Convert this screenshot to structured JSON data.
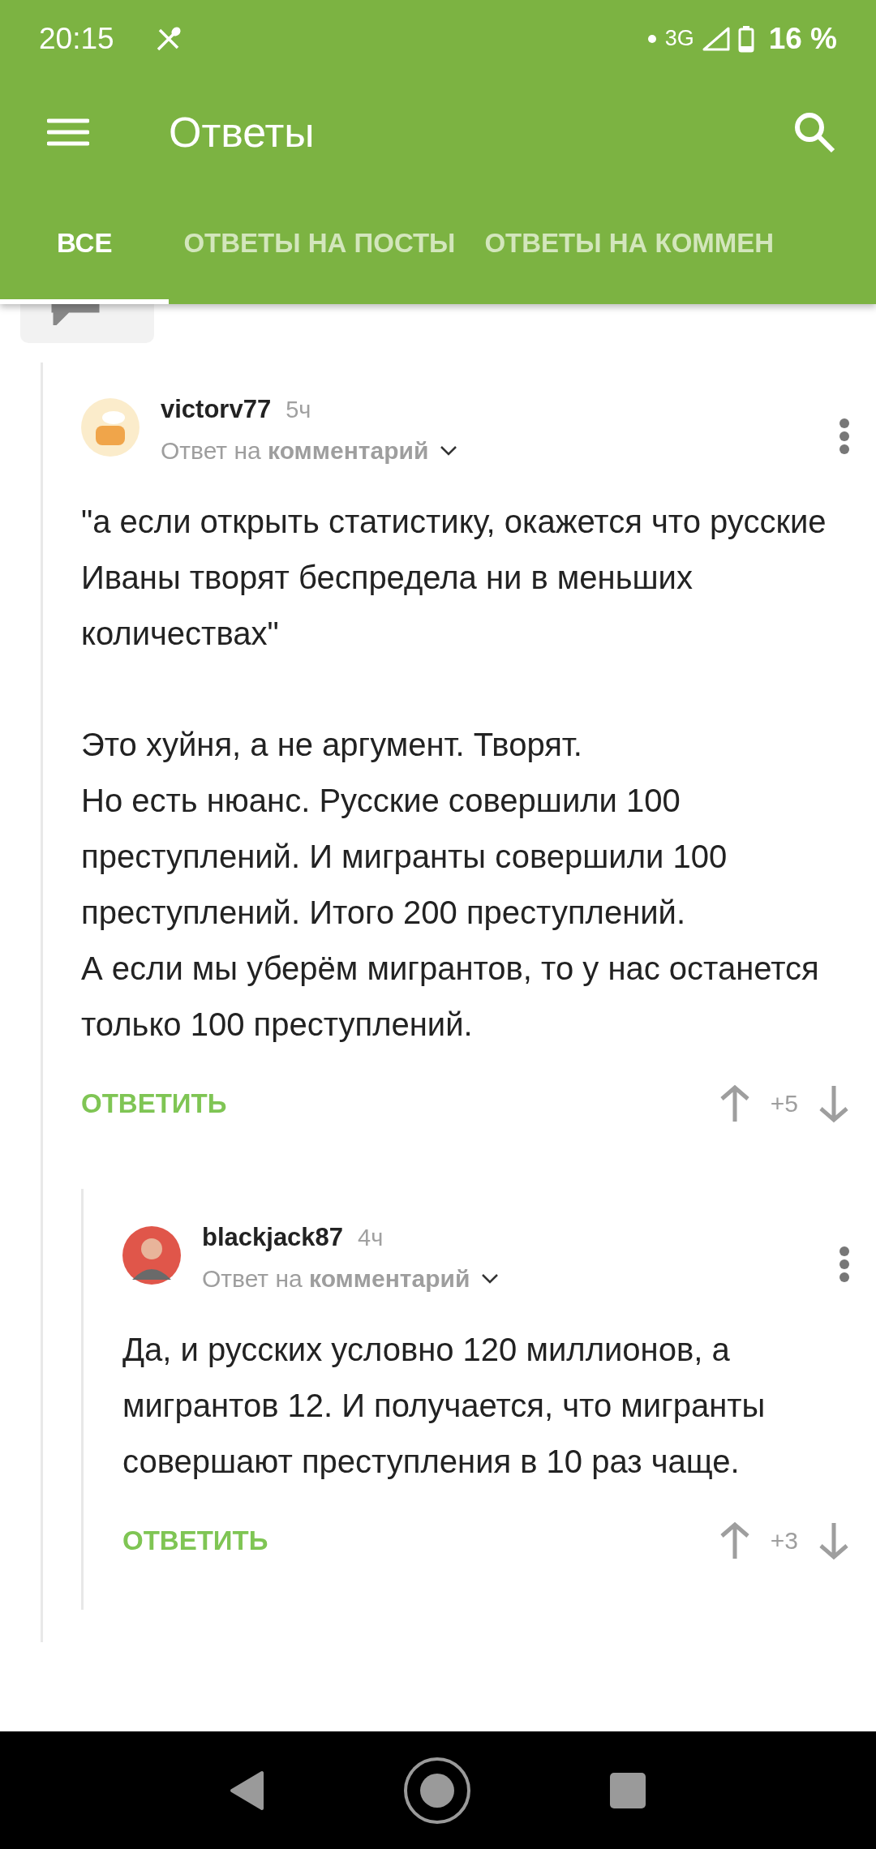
{
  "status_bar": {
    "time": "20:15",
    "network": "3G",
    "battery": "16 %"
  },
  "app_bar": {
    "title": "Ответы"
  },
  "tabs": [
    {
      "label": "ВСЕ",
      "selected": true
    },
    {
      "label": "ОТВЕТЫ НА ПОСТЫ",
      "selected": false
    },
    {
      "label": "ОТВЕТЫ НА КОММЕН",
      "selected": false
    }
  ],
  "comments": [
    {
      "author": "victorv77",
      "age": "5ч",
      "reply_prefix": "Ответ на",
      "reply_target": "комментарий",
      "paragraphs": [
        "\"а если открыть статистику, окажется что русские Иваны творят беспредела ни в меньших количествах\"",
        "Это хуйня, а не аргумент. Творят.\nНо есть нюанс. Русские совершили 100 преступлений. И мигранты совершили 100 преступлений. Итого 200 преступлений.\nА если мы уберём мигрантов, то у нас останется только 100 преступлений."
      ],
      "reply_action": "ОТВЕТИТЬ",
      "score": "+5",
      "children": [
        {
          "author": "blackjack87",
          "age": "4ч",
          "reply_prefix": "Ответ на",
          "reply_target": "комментарий",
          "paragraphs": [
            "Да, и русских условно 120 миллионов, а мигрантов 12. И получается, что мигранты совершают преступления в 10 раз чаще."
          ],
          "reply_action": "ОТВЕТИТЬ",
          "score": "+3"
        }
      ]
    }
  ]
}
